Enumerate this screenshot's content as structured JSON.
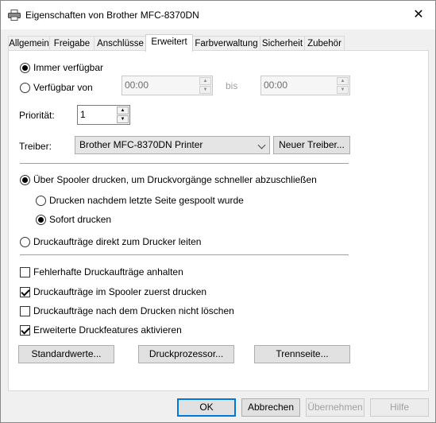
{
  "window": {
    "title": "Eigenschaften von Brother MFC-8370DN",
    "close_glyph": "✕"
  },
  "tabs": [
    {
      "label": "Allgemein"
    },
    {
      "label": "Freigabe"
    },
    {
      "label": "Anschlüsse"
    },
    {
      "label": "Erweitert",
      "active": true
    },
    {
      "label": "Farbverwaltung"
    },
    {
      "label": "Sicherheit"
    },
    {
      "label": "Zubehör"
    }
  ],
  "availability": {
    "always_label": "Immer verfügbar",
    "always_selected": true,
    "from_label": "Verfügbar von",
    "from_time": "00:00",
    "to_label": "bis",
    "to_time": "00:00"
  },
  "priority": {
    "label": "Priorität:",
    "value": "1"
  },
  "driver": {
    "label": "Treiber:",
    "selected": "Brother MFC-8370DN Printer",
    "new_button": "Neuer Treiber..."
  },
  "spooling": {
    "spool_label": "Über Spooler drucken, um Druckvorgänge schneller abzuschließen",
    "spool_selected": true,
    "after_last_page_label": "Drucken nachdem letzte Seite gespoolt wurde",
    "immediately_label": "Sofort drucken",
    "immediately_selected": true,
    "direct_label": "Druckaufträge direkt zum Drucker leiten"
  },
  "options": [
    {
      "label": "Fehlerhafte Druckaufträge anhalten",
      "checked": false
    },
    {
      "label": "Druckaufträge im Spooler zuerst drucken",
      "checked": true
    },
    {
      "label": "Druckaufträge nach dem Drucken nicht löschen",
      "checked": false
    },
    {
      "label": "Erweiterte Druckfeatures aktivieren",
      "checked": true
    }
  ],
  "panel_buttons": {
    "defaults": "Standardwerte...",
    "processor": "Druckprozessor...",
    "separator": "Trennseite..."
  },
  "dialog_buttons": {
    "ok": "OK",
    "cancel": "Abbrechen",
    "apply": "Übernehmen",
    "help": "Hilfe"
  },
  "colors": {
    "accent": "#0078d7",
    "disabled_text": "#a0a0a0"
  }
}
